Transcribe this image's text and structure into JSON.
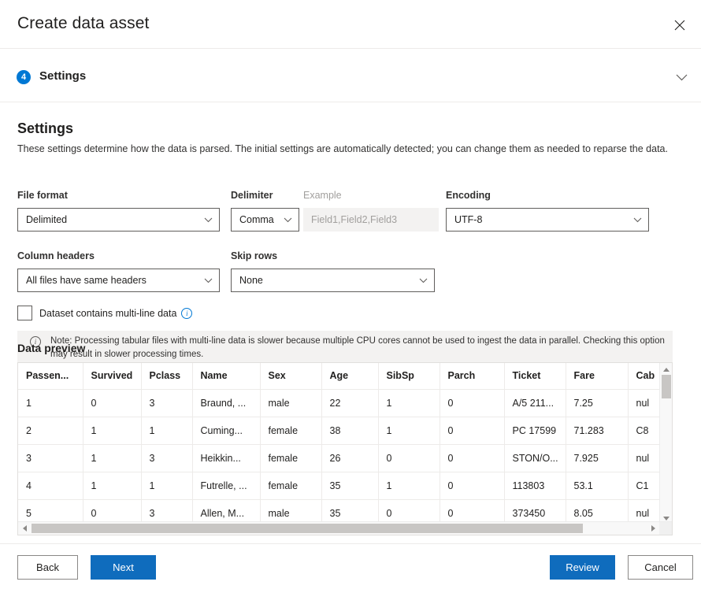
{
  "window": {
    "title": "Create data asset",
    "close_icon": "close-icon"
  },
  "step": {
    "number": "4",
    "label": "Settings",
    "collapse_icon": "chevron-down-icon"
  },
  "settings": {
    "heading": "Settings",
    "description": "These settings determine how the data is parsed. The initial settings are automatically detected; you can change them as needed to reparse the data.",
    "fields": {
      "file_format": {
        "label": "File format",
        "value": "Delimited"
      },
      "delimiter": {
        "label": "Delimiter",
        "value": "Comma"
      },
      "example": {
        "label": "Example",
        "value": "Field1,Field2,Field3"
      },
      "encoding": {
        "label": "Encoding",
        "value": "UTF-8"
      },
      "column_headers": {
        "label": "Column headers",
        "value": "All files have same headers"
      },
      "skip_rows": {
        "label": "Skip rows",
        "value": "None"
      }
    },
    "multiline_checkbox": {
      "label": "Dataset contains multi-line data",
      "checked": false,
      "info_icon": "info-circle-icon"
    },
    "note": {
      "icon": "info-circle-icon",
      "text": "Note: Processing tabular files with multi-line data is slower because multiple CPU cores cannot be used to ingest the data in parallel. Checking this option may result in slower processing times."
    }
  },
  "data_preview": {
    "heading": "Data preview",
    "columns": [
      "Passen...",
      "Survived",
      "Pclass",
      "Name",
      "Sex",
      "Age",
      "SibSp",
      "Parch",
      "Ticket",
      "Fare",
      "Cab"
    ],
    "rows": [
      [
        "1",
        "0",
        "3",
        "Braund, ...",
        "male",
        "22",
        "1",
        "0",
        "A/5 211...",
        "7.25",
        "nul"
      ],
      [
        "2",
        "1",
        "1",
        "Cuming...",
        "female",
        "38",
        "1",
        "0",
        "PC 17599",
        "71.283",
        "C8"
      ],
      [
        "3",
        "1",
        "3",
        "Heikkin...",
        "female",
        "26",
        "0",
        "0",
        "STON/O...",
        "7.925",
        "nul"
      ],
      [
        "4",
        "1",
        "1",
        "Futrelle, ...",
        "female",
        "35",
        "1",
        "0",
        "113803",
        "53.1",
        "C1"
      ],
      [
        "5",
        "0",
        "3",
        "Allen, M...",
        "male",
        "35",
        "0",
        "0",
        "373450",
        "8.05",
        "nul"
      ]
    ]
  },
  "footer": {
    "back": "Back",
    "next": "Next",
    "review": "Review",
    "cancel": "Cancel"
  },
  "colors": {
    "accent": "#0078d4",
    "primary_button": "#0f6cbd",
    "border": "#605e5c",
    "banner_bg": "#f3f2f1"
  }
}
